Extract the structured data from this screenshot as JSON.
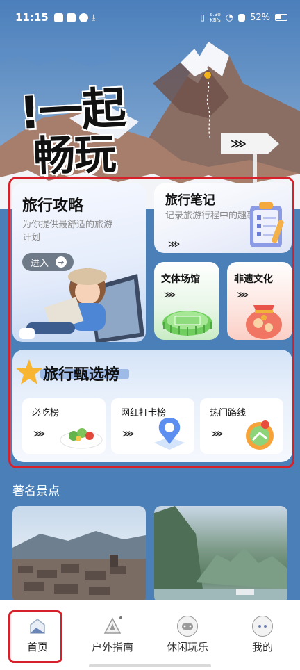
{
  "status_bar": {
    "time": "11:15",
    "net_speed_value": "6.30",
    "net_speed_unit": "KB/s",
    "battery": "52%"
  },
  "hero": {
    "slogan_line1": "!一起",
    "slogan_line2": "畅玩",
    "signpost": "⋙"
  },
  "guide_card": {
    "title": "旅行攻略",
    "subtitle": "为你提供最舒适的旅游计划",
    "enter_label": "进入",
    "enter_icon": "arrow-right-icon"
  },
  "notes_card": {
    "title": "旅行笔记",
    "subtitle": "记录旅游行程中的趣事",
    "chevrons": "⋙"
  },
  "venue_card": {
    "title": "文体场馆",
    "chevrons": "⋙"
  },
  "heritage_card": {
    "title": "非遗文化",
    "chevrons": "⋙"
  },
  "rank_card": {
    "title": "旅行甄选榜",
    "items": [
      {
        "label": "必吃榜",
        "chevrons": "⋙"
      },
      {
        "label": "网红打卡榜",
        "chevrons": "⋙"
      },
      {
        "label": "热门路线",
        "chevrons": "⋙"
      }
    ]
  },
  "spots": {
    "title": "著名景点"
  },
  "bottom_nav": {
    "items": [
      {
        "label": "首页",
        "icon": "home-icon"
      },
      {
        "label": "户外指南",
        "icon": "compass-icon"
      },
      {
        "label": "休闲玩乐",
        "icon": "gamepad-icon"
      },
      {
        "label": "我的",
        "icon": "profile-icon"
      }
    ]
  },
  "colors": {
    "accent_red": "#d6202a",
    "background_blue": "#4a7fb8"
  }
}
